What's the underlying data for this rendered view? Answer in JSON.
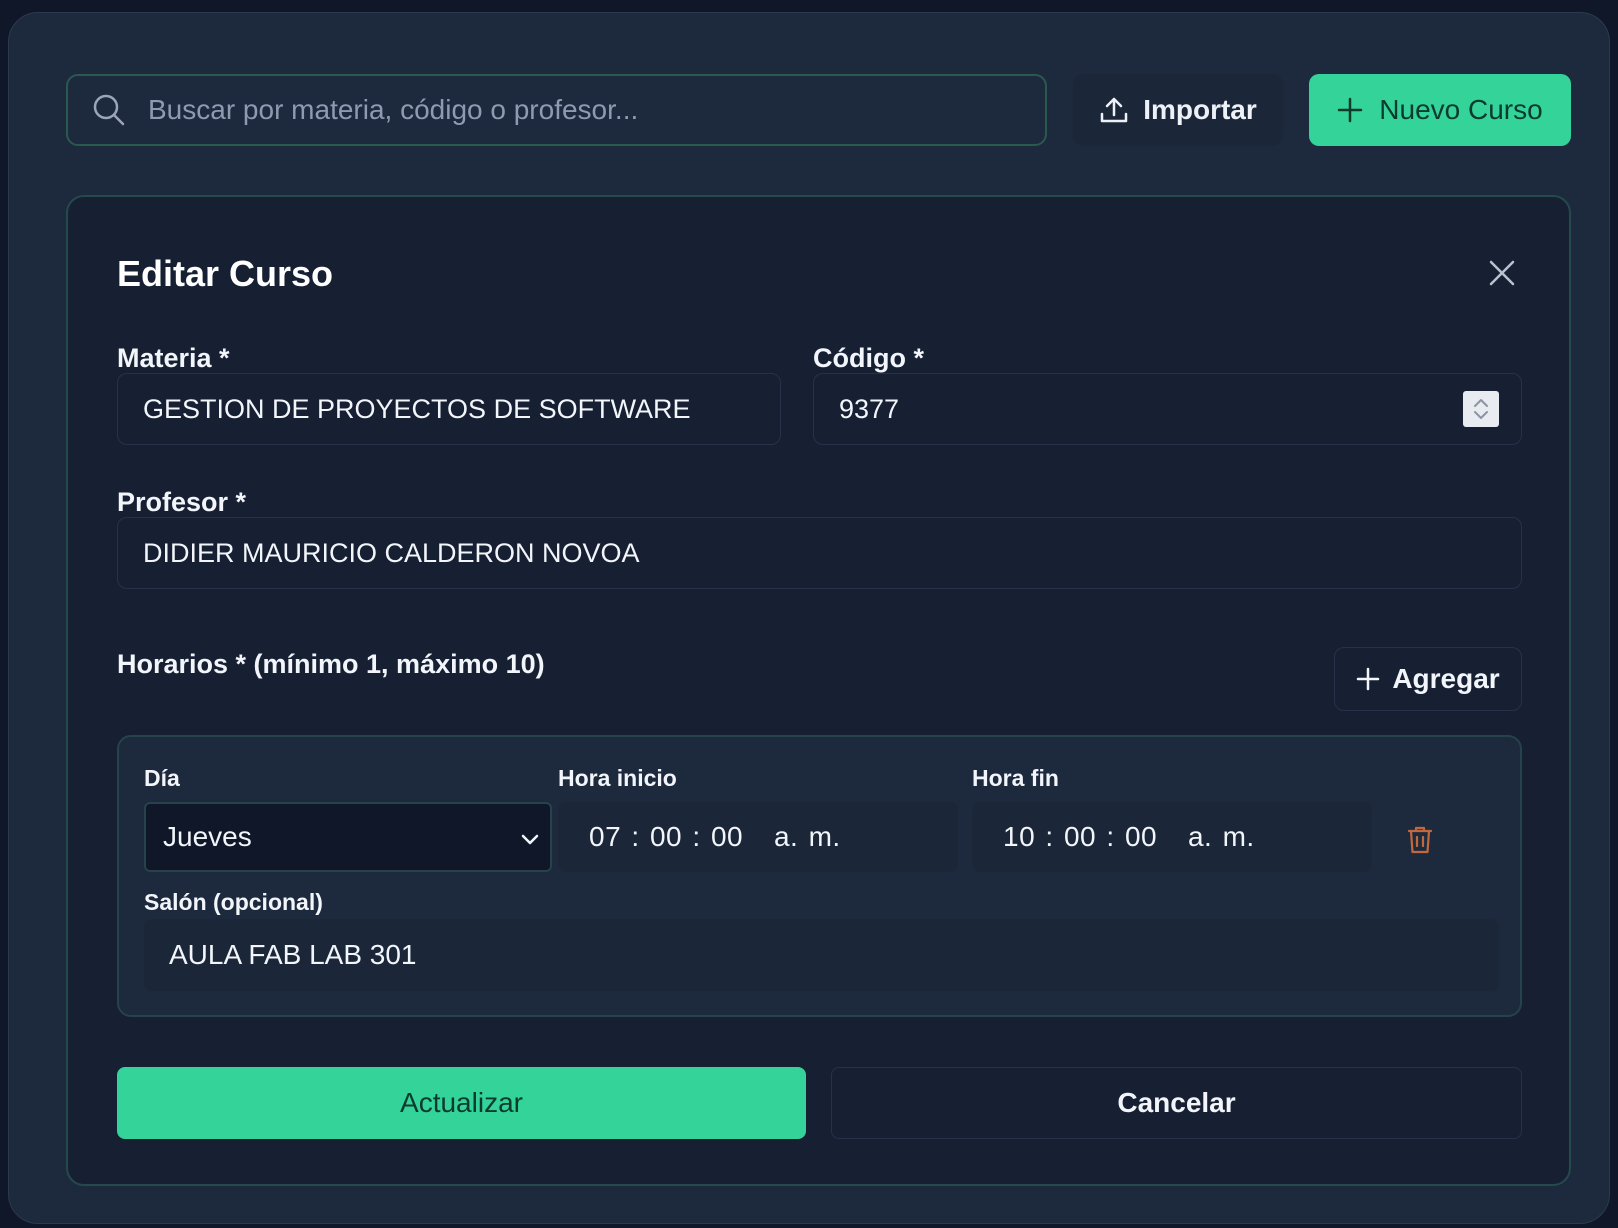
{
  "search": {
    "placeholder": "Buscar por materia, código o profesor..."
  },
  "toolbar": {
    "import_label": "Importar",
    "new_label": "Nuevo Curso"
  },
  "dialog": {
    "title": "Editar Curso",
    "subject_label": "Materia *",
    "subject_value": "GESTION DE PROYECTOS DE SOFTWARE",
    "code_label": "Código *",
    "code_value": "9377",
    "teacher_label": "Profesor *",
    "teacher_value": "DIDIER MAURICIO CALDERON NOVOA",
    "schedules_label": "Horarios * (mínimo 1, máximo 10)",
    "add_label": "Agregar",
    "update_label": "Actualizar",
    "cancel_label": "Cancelar"
  },
  "schedule": {
    "day_label": "Día",
    "day_value": "Jueves",
    "start_label": "Hora inicio",
    "start_value": "07 : 00 : 00   a. m.",
    "end_label": "Hora fin",
    "end_value": "10 : 00 : 00   a. m.",
    "room_label": "Salón (opcional)",
    "room_value": "AULA FAB LAB 301"
  },
  "colors": {
    "accent": "#34d399",
    "danger": "#c2683f",
    "background": "#1d2a3d"
  },
  "icons": [
    "search-icon",
    "upload-icon",
    "plus-icon",
    "close-icon",
    "chevron-down-icon",
    "trash-icon",
    "spinner-icon"
  ]
}
